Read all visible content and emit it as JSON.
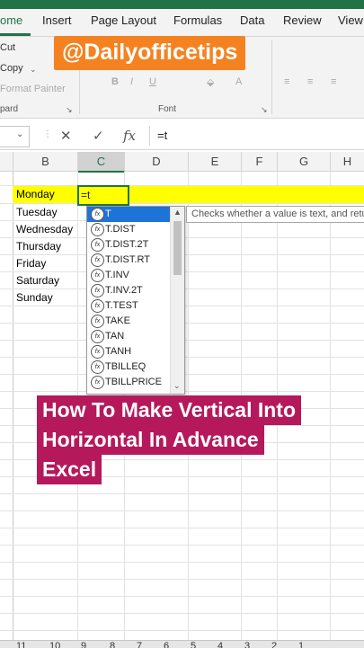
{
  "ribbon": {
    "tabs": [
      "ome",
      "Insert",
      "Page Layout",
      "Formulas",
      "Data",
      "Review",
      "View"
    ],
    "clipboard": {
      "cut": "Cut",
      "copy": "Copy",
      "format_painter": "Format Painter",
      "group_label": "pard"
    },
    "font": {
      "bold": "B",
      "italic": "I",
      "underline": "U",
      "group_label": "Font"
    }
  },
  "overlay": {
    "handle": "@Dailyofficetips",
    "title_lines": [
      "How To Make Vertical Into",
      "Horizontal In Advance",
      "Excel"
    ]
  },
  "formula_bar": {
    "cancel": "✕",
    "enter": "✓",
    "fx": "fx",
    "value": "=t"
  },
  "grid": {
    "columns": [
      "B",
      "C",
      "D",
      "E",
      "F",
      "G",
      "H"
    ],
    "cells": [
      "Monday",
      "Tuesday",
      "Wednesday",
      "Thursday",
      "Friday",
      "Saturday",
      "Sunday"
    ],
    "active_cell_value": "=t",
    "highlight_color": "#ffff00"
  },
  "autocomplete": {
    "items": [
      "T",
      "T.DIST",
      "T.DIST.2T",
      "T.DIST.RT",
      "T.INV",
      "T.INV.2T",
      "T.TEST",
      "TAKE",
      "TAN",
      "TANH",
      "TBILLEQ",
      "TBILLPRICE"
    ],
    "selected_index": 0,
    "tooltip": "Checks whether a value is text, and retu"
  },
  "sheets": [
    "11",
    "10",
    "9",
    "8",
    "7",
    "6",
    "5",
    "4",
    "3",
    "2",
    "1"
  ],
  "colors": {
    "accent": "#217346",
    "handle_bg": "#f58220",
    "title_bg": "#b5195b",
    "selection": "#1e73d8"
  }
}
